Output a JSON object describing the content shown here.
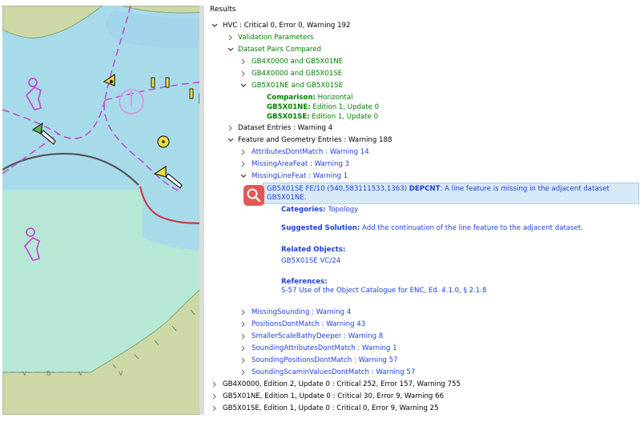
{
  "colors": {
    "deep_water": "#a8dbea",
    "shallow_water": "#b7e8d6",
    "land": "#cdd8a6",
    "land_edge": "#7fa87f",
    "chart_magenta": "#c24fd0",
    "depth_contour": "#c93b4b",
    "text_green": "#008000",
    "text_blue": "#1f3fd8",
    "selection": "#d8e9f8",
    "magnifier": "#e45757"
  },
  "results": {
    "title": "Results",
    "hvc": {
      "label": "HVC : Critical 0, Error 0, Warning 192"
    },
    "validation_parameters": {
      "label": "Validation Parameters"
    },
    "dataset_pairs": {
      "label": "Dataset Pairs Compared"
    },
    "pair_1": {
      "label": "GB4X0000 and GB5X01NE"
    },
    "pair_2": {
      "label": "GB4X0000 and GB5X01SE"
    },
    "pair_3": {
      "label": "GB5X01NE and GB5X01SE"
    },
    "comparison": {
      "key": "Comparison:",
      "value": " Horizontal"
    },
    "edition_ne": {
      "key": "GB5X01NE:",
      "value": " Edition 1, Update 0"
    },
    "edition_se": {
      "key": "GB5X01SE:",
      "value": " Edition 1, Update 0"
    },
    "dataset_entries": {
      "label": "Dataset Entries : Warning 4"
    },
    "feature_geometry": {
      "label": "Feature and Geometry Entries : Warning 188"
    },
    "attributes_dont_match": {
      "label": "AttributesDontMatch : Warning 14"
    },
    "missing_area_feat": {
      "label": "MissingAreaFeat : Warning 3"
    },
    "missing_line_feat": {
      "label": "MissingLineFeat : Warning 1"
    },
    "selected_issue": {
      "line1_prefix": "GB5X01SE FE/10 (540,583111533,1363) ",
      "line1_code": "DEPCNT",
      "line1_rest": ": A line feature is missing in the adjacent dataset",
      "line2": "GB5X01NE."
    },
    "categories": {
      "key": "Categories:",
      "value": " Topology"
    },
    "suggested_solution": {
      "key": "Suggested Solution:",
      "value": " Add the continuation of the line feature to the adjacent dataset."
    },
    "related_objects": {
      "heading": "Related Objects:",
      "value": "GB5X01SE VC/24"
    },
    "references": {
      "heading": "References:",
      "value": "S-57 Use of the Object Catalogue for ENC, Ed. 4.1.0, § 2.1.8"
    },
    "missing_sounding": {
      "label": "MissingSounding : Warning 4"
    },
    "positions_dont_match": {
      "label": "PositionsDontMatch : Warning 43"
    },
    "smaller_scale": {
      "label": "SmallerScaleBathyDeeper : Warning 8"
    },
    "sounding_attributes": {
      "label": "SoundingAttributesDontMatch : Warning 1"
    },
    "sounding_positions": {
      "label": "SoundingPositionsDontMatch : Warning 57"
    },
    "sounding_scamin": {
      "label": "SoundingScaminValuesDontMatch : Warning 57"
    },
    "gb4x0000": {
      "label": "GB4X0000, Edition 2, Update 0 : Critical 252, Error 157, Warning 755"
    },
    "gb5x01ne": {
      "label": "GB5X01NE, Edition 1, Update 0 : Critical 30, Error 9, Warning 66"
    },
    "gb5x01se": {
      "label": "GB5X01SE, Edition 1, Update 0 : Critical 0, Error 9, Warning 25"
    }
  }
}
